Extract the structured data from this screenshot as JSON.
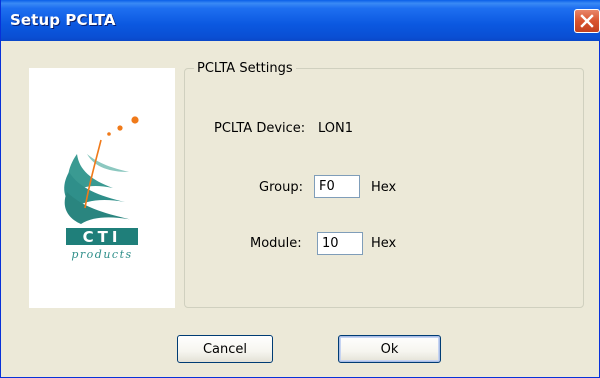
{
  "window": {
    "title": "Setup PCLTA"
  },
  "logo": {
    "brand": "CTI",
    "tagline": "products"
  },
  "settings": {
    "legend": "PCLTA Settings",
    "device_label": "PCLTA Device:",
    "device_value": "LON1",
    "group_label": "Group:",
    "group_value": "F0",
    "module_label": "Module:",
    "module_value": "10",
    "unit_label": "Hex"
  },
  "buttons": {
    "cancel": "Cancel",
    "ok": "Ok"
  },
  "icons": {
    "close": "close-icon"
  },
  "colors": {
    "title_bar": "#0a58e0",
    "close_button": "#d9542f",
    "logo_teal": "#2f8f8a",
    "logo_orange": "#f07a1a"
  }
}
